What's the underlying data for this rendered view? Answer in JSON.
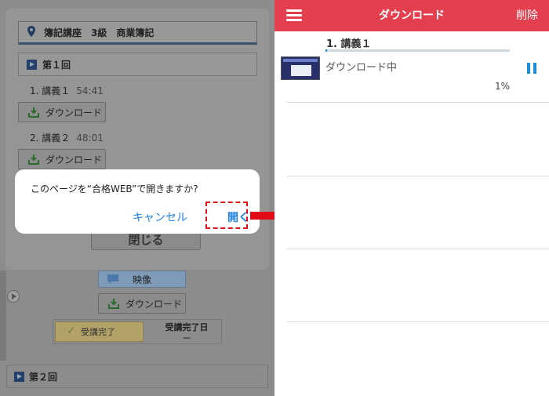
{
  "left_screen": {
    "course_title": "簿記講座　3級　商業簿記",
    "round1_label": "第１回",
    "lectures": [
      {
        "label": "1.  講義１",
        "time": "54:41"
      },
      {
        "label": "2.  講義２",
        "time": "48:01"
      }
    ],
    "download_label": "ダウンロード",
    "close_label": "閉じる",
    "watch_label": "映像",
    "completed_label": "受講完了",
    "completed_date_label": "受講完了日",
    "completed_date_value": "ー",
    "round2_label": "第２回"
  },
  "dialog": {
    "message": "このページを“合格WEB”で開きますか?",
    "cancel_label": "キャンセル",
    "open_label": "開く"
  },
  "right_screen": {
    "title": "ダウンロード",
    "delete_label": "削除",
    "lecture_title": "1.  講義１",
    "status": "ダウンロード中",
    "progress_percent": 1,
    "progress_label": "1%"
  },
  "colors": {
    "appbar": "#e43f4e",
    "accent_blue": "#1a8fd8",
    "dialog_link": "#1f82e6",
    "highlight": "#e20b17"
  },
  "icons": [
    "pin-icon",
    "play-icon",
    "download-icon",
    "video-icon",
    "check-icon",
    "menu-icon",
    "pause-icon",
    "arrow-icon"
  ]
}
